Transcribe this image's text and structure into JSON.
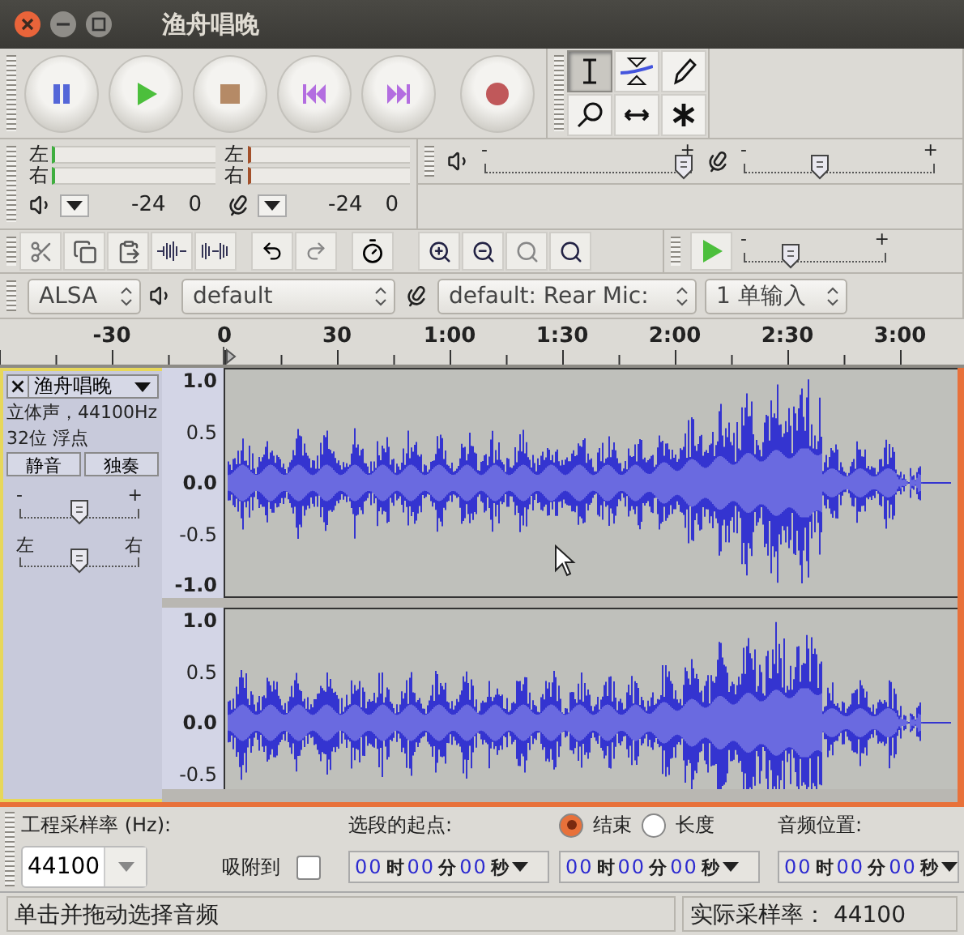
{
  "window": {
    "title": "渔舟唱晚"
  },
  "tools": [
    {
      "selected": true
    },
    {
      "selected": false
    },
    {
      "selected": false
    },
    {
      "selected": false
    },
    {
      "selected": false
    },
    {
      "selected": false
    }
  ],
  "meters": [
    {
      "channels": [
        "左",
        "右"
      ],
      "scale": [
        "-24",
        "0"
      ]
    },
    {
      "channels": [
        "左",
        "右"
      ],
      "scale": [
        "-24",
        "0"
      ]
    }
  ],
  "mixer": {
    "output": {
      "minus": "-",
      "plus": "+",
      "level": 0.97
    },
    "input": {
      "minus": "-",
      "plus": "+",
      "level": 0.4
    }
  },
  "play_at_speed": {
    "minus": "-",
    "plus": "+",
    "level": 0.33
  },
  "devices": {
    "host": "ALSA",
    "output": "default",
    "input": "default: Rear Mic:",
    "channels": "1 单输入"
  },
  "ruler": [
    "-30",
    "0",
    "30",
    "1:00",
    "1:30",
    "2:00",
    "2:30",
    "3:00"
  ],
  "track": {
    "name": "渔舟唱晚",
    "info": [
      "立体声，44100Hz",
      "32位 浮点"
    ],
    "mute": {
      "label": "静音",
      "selected": false
    },
    "solo": {
      "label": "独奏",
      "selected": false
    },
    "gain": {
      "minus": "-",
      "plus": "+",
      "level": 0.5
    },
    "pan": {
      "left": "左",
      "right": "右",
      "level": 0.5
    },
    "channels": [
      {
        "scale": [
          "1.0",
          "0.5",
          "0.0",
          "-0.5",
          "-1.0"
        ]
      },
      {
        "scale": [
          "1.0",
          "0.5",
          "0.0",
          "-0.5"
        ]
      }
    ]
  },
  "selection_bar": {
    "rate_label": "工程采样率 (Hz):",
    "rate": "44100",
    "snap_label": "吸附到",
    "snap": {
      "checked": false
    },
    "start_label": "选段的起点:",
    "modes": [
      {
        "label": "结束",
        "selected": true
      },
      {
        "label": "长度",
        "selected": false
      }
    ],
    "position_label": "音频位置:",
    "times": [
      [
        "00",
        "时",
        "00",
        "分",
        "00",
        "秒"
      ],
      [
        "00",
        "时",
        "00",
        "分",
        "00",
        "秒"
      ],
      [
        "00",
        "时",
        "00",
        "分",
        "00",
        "秒"
      ]
    ]
  },
  "status_bar": {
    "message": "单击并拖动选择音频",
    "rate": "实际采样率： 44100"
  }
}
